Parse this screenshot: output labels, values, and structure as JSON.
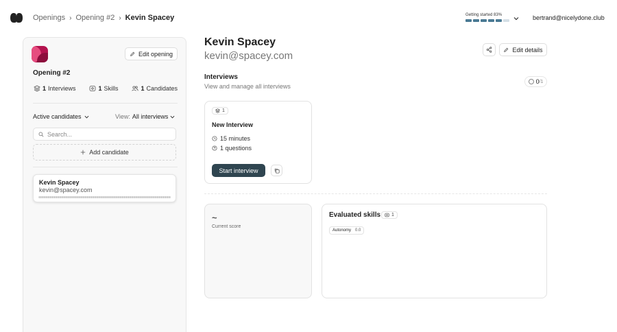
{
  "header": {
    "breadcrumb": [
      "Openings",
      "Opening #2"
    ],
    "breadcrumb_current": "Kevin Spacey",
    "progress": {
      "label": "Getting started 83%",
      "value": 0.83,
      "segments_filled": 5,
      "segments_total": 6
    },
    "user_email": "bertrand@nicelydone.club"
  },
  "sidebar": {
    "edit_opening_label": "Edit opening",
    "opening_title": "Opening #2",
    "stats": {
      "interviews": {
        "count": "1",
        "label": "Interviews"
      },
      "skills": {
        "count": "1",
        "label": "Skills"
      },
      "candidates": {
        "count": "1",
        "label": "Candidates"
      }
    },
    "filter_label": "Active candidates",
    "view_prefix": "View:",
    "view_value": "All interviews",
    "search_placeholder": "Search...",
    "add_candidate_label": "Add candidate",
    "candidates": [
      {
        "name": "Kevin Spacey",
        "email": "kevin@spacey.com"
      }
    ]
  },
  "main": {
    "name": "Kevin Spacey",
    "email": "kevin@spacey.com",
    "edit_details_label": "Edit details",
    "section_title": "Interviews",
    "section_subtitle": "View and manage all interviews",
    "counter": {
      "value": "0",
      "total": "/1"
    },
    "interview": {
      "badge": "1",
      "title": "New Interview",
      "duration": "15 minutes",
      "questions": "1 questions",
      "start_label": "Start interview"
    },
    "score": {
      "value": "~",
      "label": "Current score"
    },
    "skills": {
      "title": "Evaluated skills",
      "badge": "1",
      "items": [
        {
          "name": "Autonomy",
          "value": "0.0"
        }
      ]
    }
  },
  "colors": {
    "primary_button": "#2f4550",
    "progress": "#4a7a94",
    "avatar": "#b3124e"
  }
}
